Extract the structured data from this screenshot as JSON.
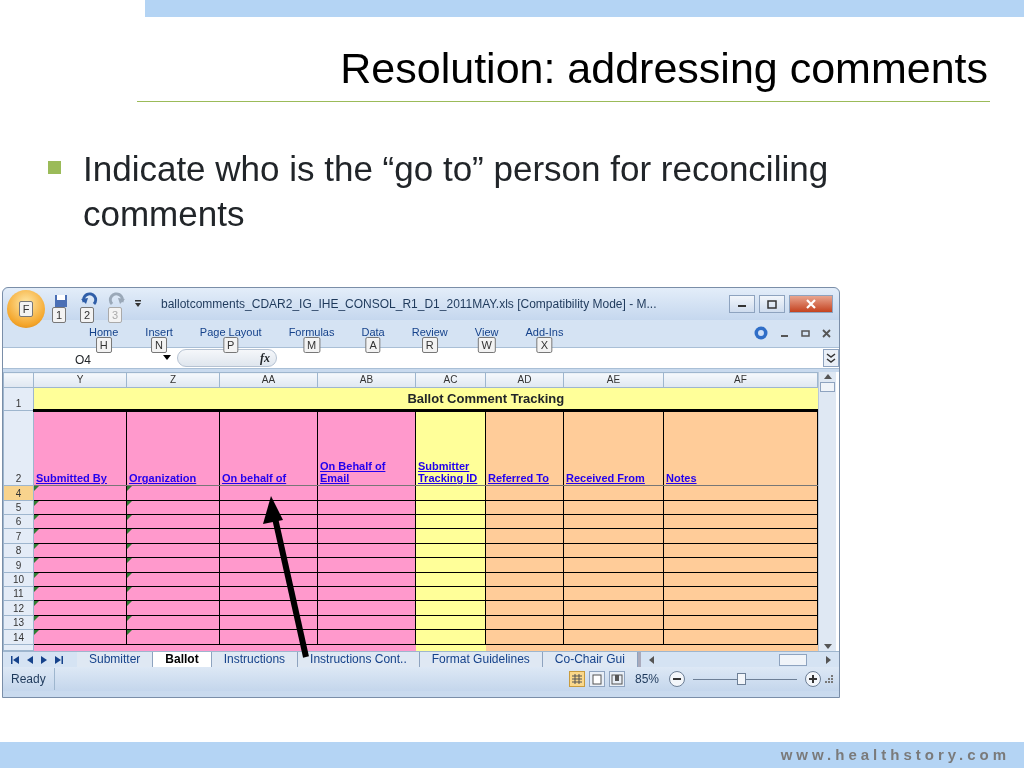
{
  "slide": {
    "title": "Resolution: addressing comments",
    "bullets": [
      "Indicate who is the “go to” person for reconciling comments"
    ],
    "footer": "www.healthstory.com"
  },
  "excel": {
    "office_keytip": "F",
    "quick_access": [
      {
        "keytip": "1",
        "disabled": false
      },
      {
        "keytip": "2",
        "disabled": false
      },
      {
        "keytip": "3",
        "disabled": true
      }
    ],
    "title": "ballotcomments_CDAR2_IG_IHE_CONSOL_R1_D1_2011MAY.xls  [Compatibility Mode] - M...",
    "ribbon_tabs": [
      {
        "label": "Home",
        "keytip": "H"
      },
      {
        "label": "Insert",
        "keytip": "N"
      },
      {
        "label": "Page Layout",
        "keytip": "P"
      },
      {
        "label": "Formulas",
        "keytip": "M"
      },
      {
        "label": "Data",
        "keytip": "A"
      },
      {
        "label": "Review",
        "keytip": "R"
      },
      {
        "label": "View",
        "keytip": "W"
      },
      {
        "label": "Add-Ins",
        "keytip": "X"
      }
    ],
    "name_box": "O4",
    "formula_label": "fx",
    "columns": [
      {
        "letter": "Y",
        "header": "Submitted By",
        "color": "#ff99cc",
        "flagged": true
      },
      {
        "letter": "Z",
        "header": "Organization",
        "color": "#ff99cc",
        "flagged": true
      },
      {
        "letter": "AA",
        "header": "On behalf of",
        "color": "#ff99cc",
        "flagged": false
      },
      {
        "letter": "AB",
        "header": "On Behalf of Email",
        "color": "#ff99cc",
        "flagged": false
      },
      {
        "letter": "AC",
        "header": "Submitter Tracking ID",
        "color": "#ffff99",
        "flagged": false
      },
      {
        "letter": "AD",
        "header": "Referred To",
        "color": "#ffcc99",
        "flagged": false
      },
      {
        "letter": "AE",
        "header": "Received From",
        "color": "#ffcc99",
        "flagged": false
      },
      {
        "letter": "AF",
        "header": "Notes",
        "color": "#ffcc99",
        "flagged": false
      }
    ],
    "title_row": {
      "number": "1",
      "text": "Ballot Comment Tracking"
    },
    "header_row": {
      "number": "2"
    },
    "data_rows": [
      {
        "number": "4",
        "selected": true
      },
      {
        "number": "5",
        "selected": false
      },
      {
        "number": "6",
        "selected": false
      },
      {
        "number": "7",
        "selected": false
      },
      {
        "number": "8",
        "selected": false
      },
      {
        "number": "9",
        "selected": false
      },
      {
        "number": "10",
        "selected": false
      },
      {
        "number": "11",
        "selected": false
      },
      {
        "number": "12",
        "selected": false
      },
      {
        "number": "13",
        "selected": false
      },
      {
        "number": "14",
        "selected": false
      }
    ],
    "sheet_tabs": [
      {
        "label": "Submitter",
        "selected": false
      },
      {
        "label": "Ballot",
        "selected": true
      },
      {
        "label": "Instructions",
        "selected": false
      },
      {
        "label": "Instructions Cont..",
        "selected": false
      },
      {
        "label": "Format Guidelines",
        "selected": false
      },
      {
        "label": "Co-Chair Gui",
        "selected": false
      }
    ],
    "status": "Ready",
    "views": [
      {
        "selected": true
      },
      {
        "selected": false
      },
      {
        "selected": false
      }
    ],
    "zoom": {
      "reading": "85%",
      "level": 0.46
    }
  }
}
